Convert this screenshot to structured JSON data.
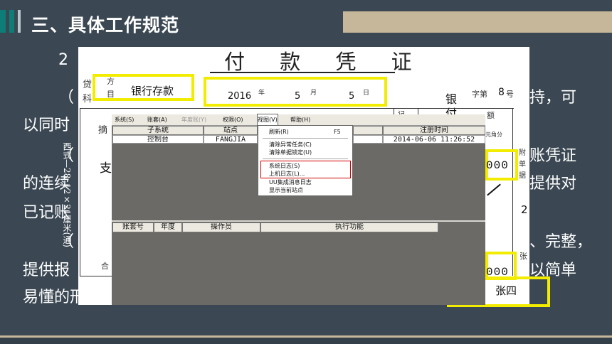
{
  "slide": {
    "title": "三、具体工作规范",
    "bg_lines": {
      "line1_left": "2",
      "line2_left": "（",
      "line2_right": "持，可",
      "line3_left": "以同时",
      "line4_left": "（",
      "line4_right": "账凭证",
      "line5_left": "的连续",
      "line5_right": "提供对",
      "line6_left": "已记账",
      "line7_left": "（",
      "line7_right": "、完整，",
      "line8_left": "提供报",
      "line8_right": "以简单",
      "line9_left": "易懂的形式"
    }
  },
  "voucher": {
    "title": "付 款 凭 证",
    "credit_label_top": "方",
    "credit_label_bottom": "目",
    "credit_left_top": "贷",
    "credit_left_bottom": "科",
    "credit_account": "银行存款",
    "date_year": "2016",
    "year_char": "年",
    "date_month": "5",
    "month_char": "月",
    "date_day": "5",
    "day_char": "日",
    "bank_char1": "银",
    "bank_char2": "付",
    "number_label": "字第",
    "number_value": "8",
    "number_suffix": "号",
    "amount_label": "额",
    "unit_labels": "元角分",
    "ji_label": "记",
    "side_text": "西式—28",
    "size_text": "12×21厘米(通)",
    "summary_label": "摘",
    "left_char": "支",
    "total_label": "合",
    "amount1": "000",
    "amount2": "000",
    "attach_label1": "附",
    "attach_label2": "单",
    "attach_label3": "据",
    "attach_count": "2",
    "zhang_label": "张",
    "signer": "张四"
  },
  "app": {
    "menu": [
      {
        "label": "系统(S)",
        "enabled": true
      },
      {
        "label": "账套(A)",
        "enabled": true
      },
      {
        "label": "年度账(Y)",
        "enabled": false
      },
      {
        "label": "权限(O)",
        "enabled": true
      },
      {
        "label": "视图(V)",
        "enabled": true,
        "active": true
      },
      {
        "label": "帮助(H)",
        "enabled": true
      }
    ],
    "top_table": {
      "headers": [
        "子系统",
        "站点",
        "注册时间"
      ],
      "row": [
        "控制台",
        "FANGJIA",
        "2014-06-06 11:26:52"
      ]
    },
    "bottom_table": {
      "headers": [
        "账套号",
        "年度",
        "操作员",
        "执行功能"
      ]
    },
    "view_menu": {
      "refresh": "刷新(R)",
      "refresh_key": "F5",
      "clear_tasks": "清除异常任务(C)",
      "clear_locks": "清除单据锁定(U)",
      "system_log": "系统日志(S)",
      "login_log": "上机日志(L)...",
      "uu_log": "UU集成消息日志",
      "show_site": "显示当前站点"
    }
  }
}
